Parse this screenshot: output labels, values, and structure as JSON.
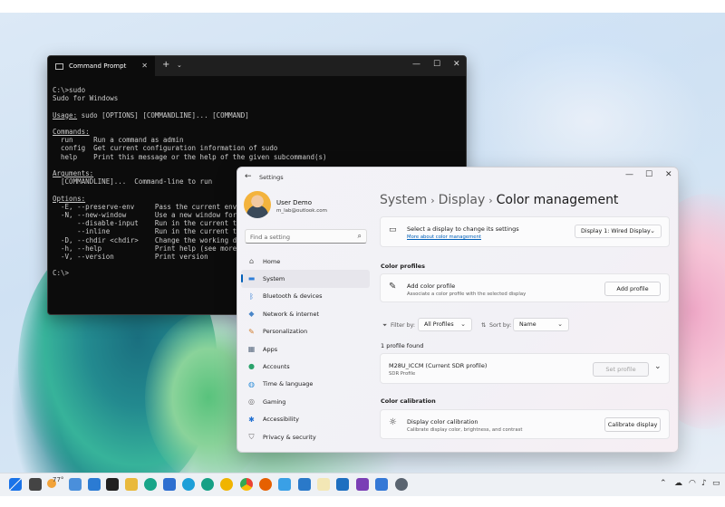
{
  "cmd": {
    "tab_title": "Command Prompt",
    "new_tab": "+",
    "dropdown": "⌄",
    "lines": [
      {
        "t": "C:\\>sudo",
        "u": false
      },
      {
        "t": "Sudo for Windows",
        "u": false
      },
      {
        "t": "",
        "u": false
      },
      {
        "t": "Usage:",
        "u": true,
        "rest": " sudo [OPTIONS] [COMMANDLINE]... [COMMAND]"
      },
      {
        "t": "",
        "u": false
      },
      {
        "t": "Commands:",
        "u": true
      },
      {
        "t": "  run     Run a command as admin",
        "u": false
      },
      {
        "t": "  config  Get current configuration information of sudo",
        "u": false
      },
      {
        "t": "  help    Print this message or the help of the given subcommand(s)",
        "u": false
      },
      {
        "t": "",
        "u": false
      },
      {
        "t": "Arguments:",
        "u": true
      },
      {
        "t": "  [COMMANDLINE]...  Command-line to run",
        "u": false
      },
      {
        "t": "",
        "u": false
      },
      {
        "t": "Options:",
        "u": true
      },
      {
        "t": "  -E, --preserve-env     Pass the current environ",
        "u": false
      },
      {
        "t": "  -N, --new-window       Use a new window for the",
        "u": false
      },
      {
        "t": "      --disable-input    Run in the current termi",
        "u": false
      },
      {
        "t": "      --inline           Run in the current termi",
        "u": false
      },
      {
        "t": "  -D, --chdir <chdir>    Change the working direc",
        "u": false
      },
      {
        "t": "  -h, --help             Print help (see more wit",
        "u": false
      },
      {
        "t": "  -V, --version          Print version",
        "u": false
      },
      {
        "t": "",
        "u": false
      },
      {
        "t": "C:\\>",
        "u": false
      }
    ]
  },
  "settings": {
    "app_title": "Settings",
    "user": {
      "name": "User Demo",
      "email": "m_lab@outlook.com"
    },
    "search_placeholder": "Find a setting",
    "nav": [
      {
        "label": "Home",
        "icon": "home-icon",
        "active": false
      },
      {
        "label": "System",
        "icon": "system-icon",
        "active": true
      },
      {
        "label": "Bluetooth & devices",
        "icon": "bluetooth-icon",
        "active": false
      },
      {
        "label": "Network & internet",
        "icon": "network-icon",
        "active": false
      },
      {
        "label": "Personalization",
        "icon": "brush-icon",
        "active": false
      },
      {
        "label": "Apps",
        "icon": "apps-icon",
        "active": false
      },
      {
        "label": "Accounts",
        "icon": "accounts-icon",
        "active": false
      },
      {
        "label": "Time & language",
        "icon": "globe-icon",
        "active": false
      },
      {
        "label": "Gaming",
        "icon": "gaming-icon",
        "active": false
      },
      {
        "label": "Accessibility",
        "icon": "accessibility-icon",
        "active": false
      },
      {
        "label": "Privacy & security",
        "icon": "shield-icon",
        "active": false
      }
    ],
    "breadcrumb": {
      "first": "System",
      "second": "Display",
      "current": "Color management"
    },
    "display_card": {
      "title": "Select a display to change its settings",
      "link": "More about color management",
      "selected": "Display 1: Wired Display"
    },
    "color_profiles": {
      "section": "Color profiles",
      "add_title": "Add color profile",
      "add_sub": "Associate a color profile with the selected display",
      "add_button": "Add profile",
      "filter_label": "Filter by:",
      "filter_value": "All Profiles",
      "sort_label": "Sort by:",
      "sort_value": "Name",
      "found": "1 profile found",
      "profile_name": "M28U_ICCM (Current SDR profile)",
      "profile_type": "SDR Profile",
      "set_button": "Set profile"
    },
    "calibration": {
      "section": "Color calibration",
      "title": "Display color calibration",
      "sub": "Calibrate display color, brightness, and contrast",
      "button": "Calibrate display"
    }
  },
  "taskbar": {
    "weather_temp": "77°",
    "time": "",
    "colors": {
      "accent": "#005fb8"
    }
  }
}
